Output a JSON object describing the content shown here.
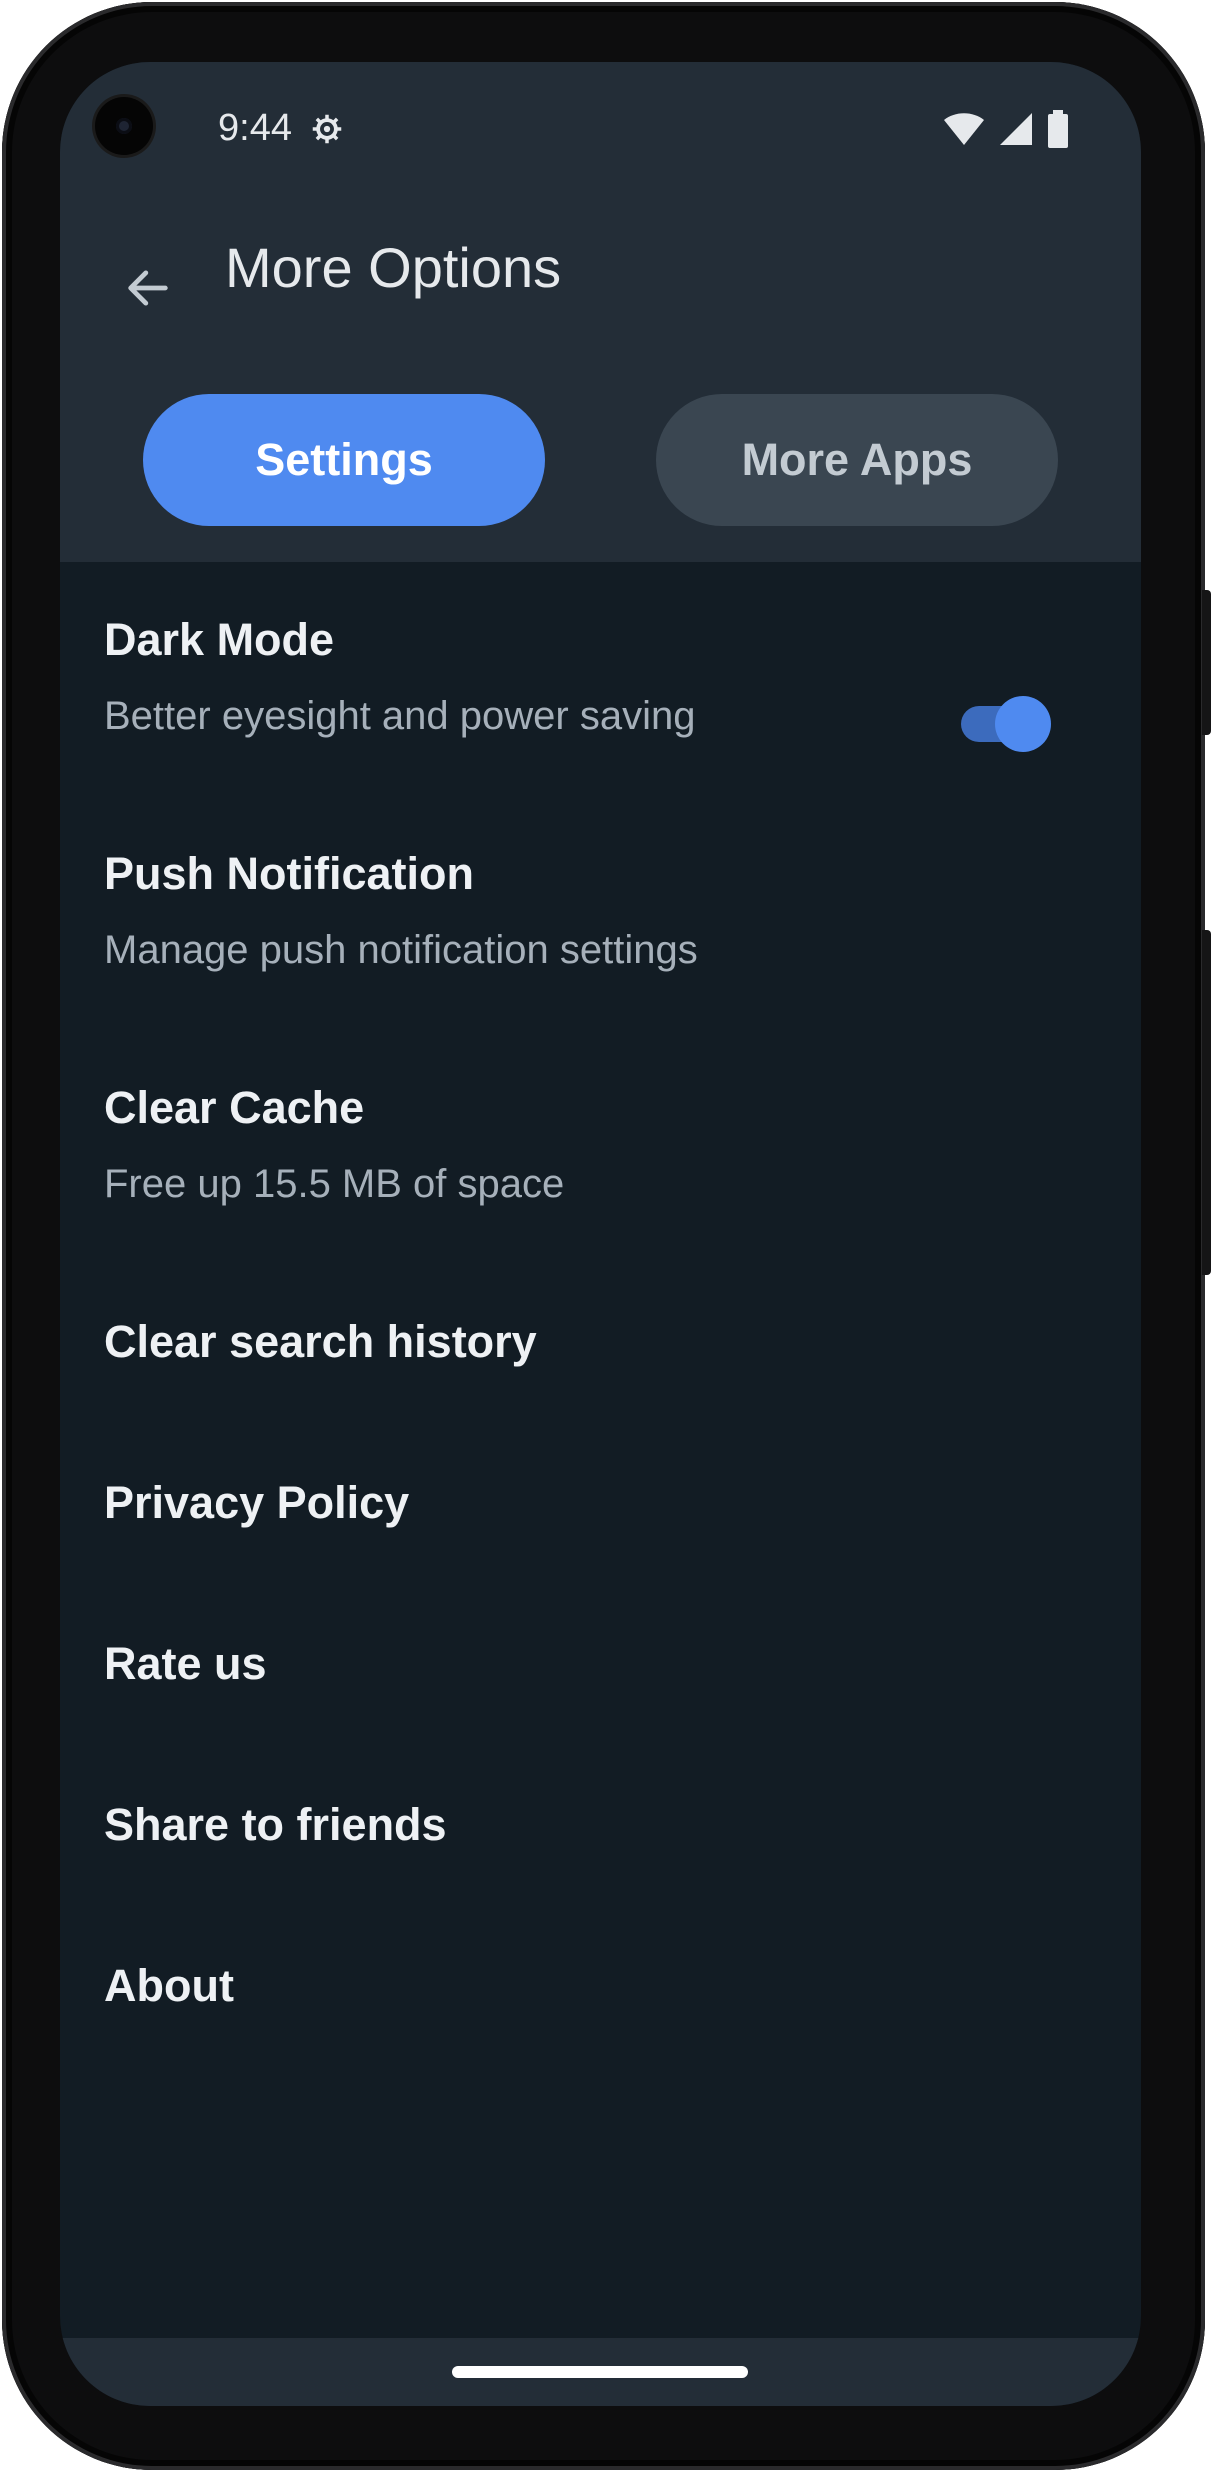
{
  "status_bar": {
    "time": "9:44",
    "icons": [
      "gear-icon",
      "wifi-icon",
      "signal-icon",
      "battery-icon"
    ]
  },
  "header": {
    "title": "More Options",
    "back_icon": "arrow-back-icon"
  },
  "tabs": [
    {
      "label": "Settings",
      "active": true
    },
    {
      "label": "More Apps",
      "active": false
    }
  ],
  "settings": {
    "dark_mode": {
      "title": "Dark Mode",
      "subtitle": "Better eyesight and power saving",
      "enabled": true
    },
    "push_notification": {
      "title": "Push Notification",
      "subtitle": "Manage push notification settings"
    },
    "clear_cache": {
      "title": "Clear Cache",
      "subtitle": "Free up 15.5 MB of space"
    },
    "clear_search_history": {
      "title": "Clear search history"
    },
    "privacy_policy": {
      "title": "Privacy Policy"
    },
    "rate_us": {
      "title": "Rate us"
    },
    "share": {
      "title": "Share to friends"
    },
    "about": {
      "title": "About"
    }
  },
  "colors": {
    "accent": "#4f8af0",
    "header_bg": "#232d37",
    "body_bg": "#121c24",
    "inactive_tab": "#3a4651"
  }
}
